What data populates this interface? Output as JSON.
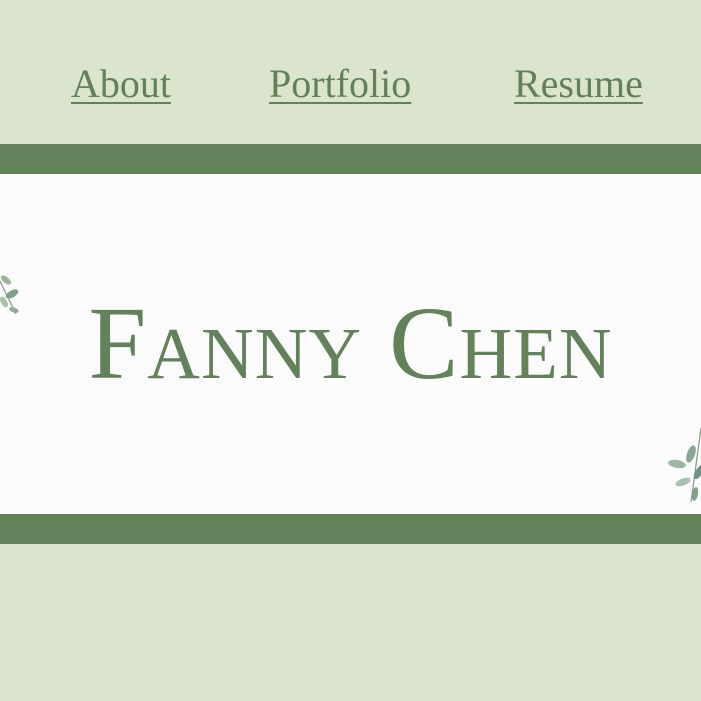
{
  "nav": {
    "about_label": "About",
    "portfolio_label": "Portfolio",
    "resume_label": "Resume"
  },
  "hero": {
    "name": "Fanny Chen",
    "decorations": [
      "eucalyptus-leaf-icon",
      "eucalyptus-leaf-icon"
    ]
  },
  "colors": {
    "background": "#dbe5cd",
    "accent_green": "#62825a",
    "hero_background": "#fbfbfb"
  }
}
